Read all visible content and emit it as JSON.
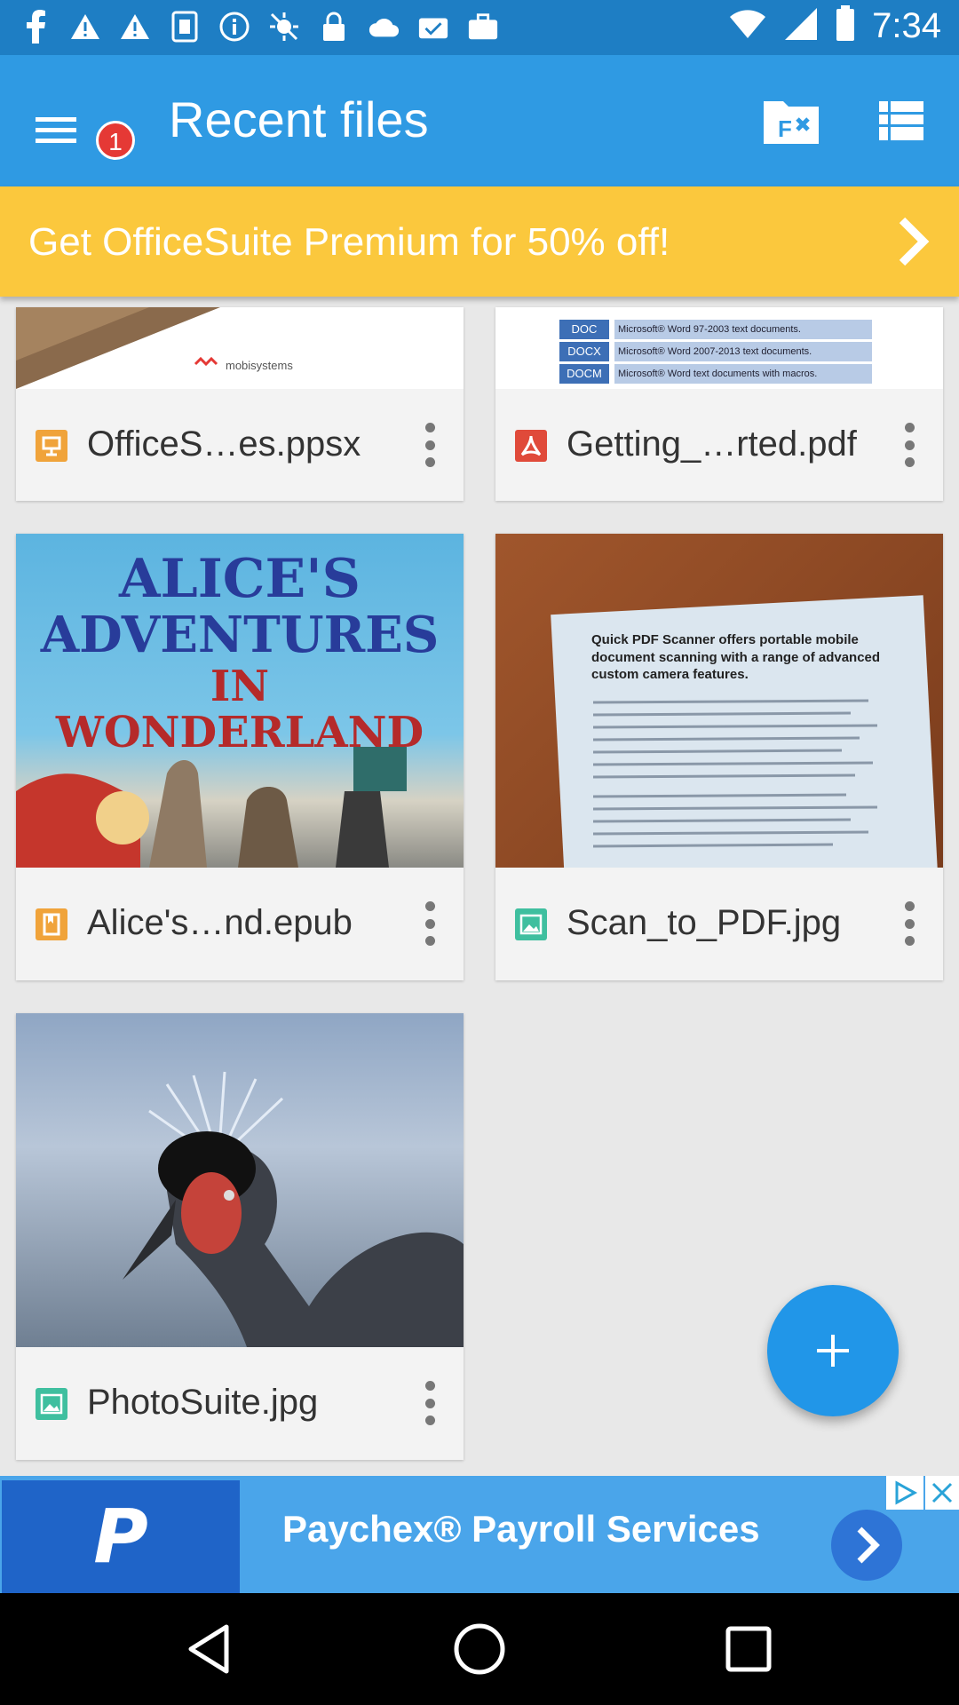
{
  "status_bar": {
    "time": "7:34",
    "icons": [
      "facebook-icon",
      "wifi-alert-icon",
      "warning-icon",
      "instagram-icon",
      "info-icon",
      "gps-off-icon",
      "lock-icon",
      "cloud-icon",
      "mail-check-icon",
      "briefcase-icon",
      "wifi-icon",
      "signal-icon",
      "battery-icon"
    ]
  },
  "app_bar": {
    "title": "Recent files",
    "menu_badge": "1"
  },
  "promo": {
    "text": "Get OfficeSuite Premium for 50% off!"
  },
  "files": [
    {
      "name": "OfficeS…es.ppsx",
      "type": "presentation",
      "icon_color": "#f0a33a",
      "thumb_label": "mobisystems"
    },
    {
      "name": "Getting_…rted.pdf",
      "type": "pdf",
      "icon_color": "#e04a3a",
      "thumb_rows": [
        {
          "tag": "DOC",
          "desc": "Microsoft® Word 97-2003 text documents."
        },
        {
          "tag": "DOCX",
          "desc": "Microsoft® Word 2007-2013 text documents."
        },
        {
          "tag": "DOCM",
          "desc": "Microsoft® Word text documents with macros."
        }
      ]
    },
    {
      "name": "Alice's…nd.epub",
      "type": "ebook",
      "icon_color": "#f0a33a",
      "thumb_lines": [
        "ALICE'S",
        "ADVENTURES",
        "IN WONDERLAND"
      ]
    },
    {
      "name": "Scan_to_PDF.jpg",
      "type": "image",
      "icon_color": "#3fbf9f",
      "thumb_lines": [
        "Quick PDF Scanner offers portable mobile",
        "document scanning with a range of advanced",
        "custom camera features."
      ]
    },
    {
      "name": "PhotoSuite.jpg",
      "type": "image",
      "icon_color": "#3fbf9f"
    }
  ],
  "ad": {
    "text": "Paychex® Payroll Services",
    "logo_letter": "P",
    "brand_color": "#1f64c8"
  },
  "colors": {
    "app_bar": "#2f9ae3",
    "status_bar": "#1e7ec4",
    "promo": "#fbc83d",
    "fab": "#2196e8"
  }
}
